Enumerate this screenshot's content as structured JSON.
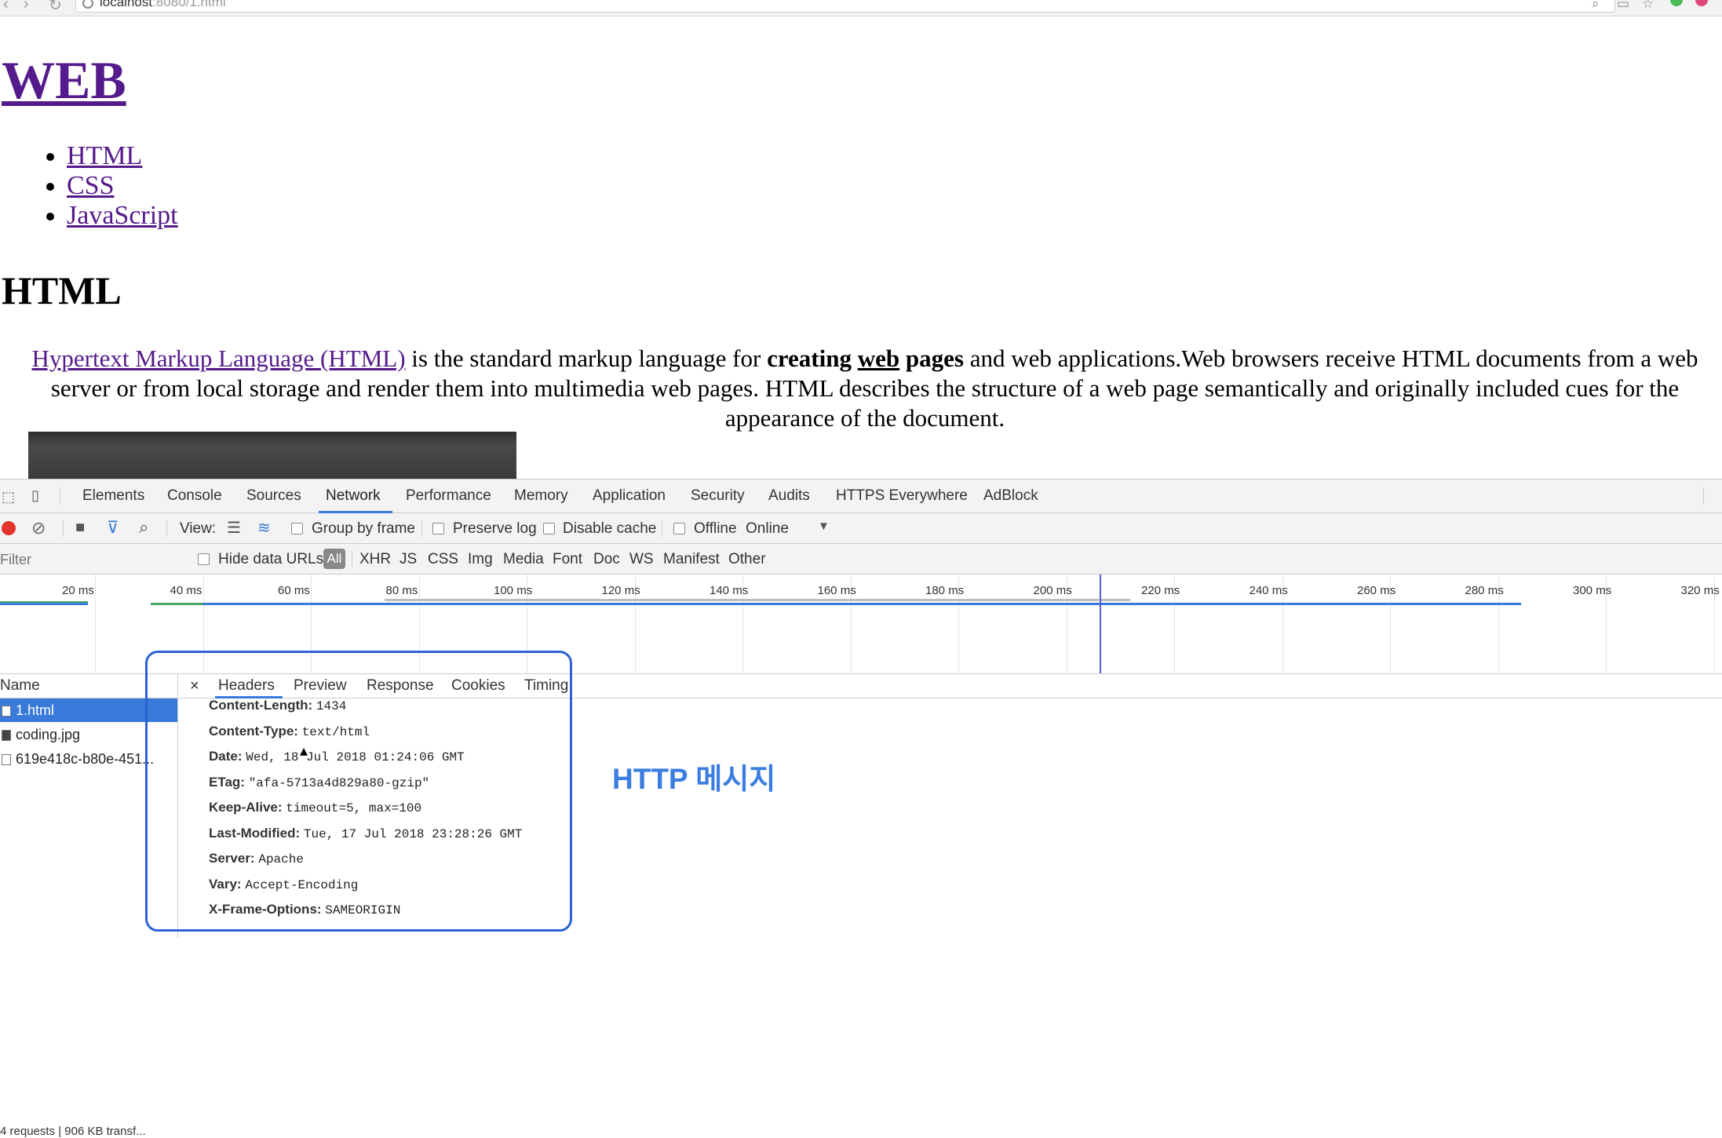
{
  "browser": {
    "url_host": "localhost",
    "url_rest": ":8080/1.html"
  },
  "page": {
    "title": "WEB",
    "nav": [
      "HTML",
      "CSS",
      "JavaScript"
    ],
    "section_title": "HTML",
    "para_link": "Hypertext Markup Language (HTML)",
    "para_text1": " is the standard markup language for ",
    "para_bold1": "creating ",
    "para_bold_under": "web",
    "para_bold2": " pages",
    "para_text2": " and web applications.Web browsers receive HTML documents from a web server or from local storage and render them into multimedia web pages. HTML describes the structure of a web page semantically and originally included cues for the appearance of the document."
  },
  "devtools": {
    "tabs": [
      "Elements",
      "Console",
      "Sources",
      "Network",
      "Performance",
      "Memory",
      "Application",
      "Security",
      "Audits",
      "HTTPS Everywhere",
      "AdBlock"
    ],
    "toolbar": {
      "view_label": "View:",
      "group_by_frame": "Group by frame",
      "preserve_log": "Preserve log",
      "disable_cache": "Disable cache",
      "offline": "Offline",
      "throttle": "Online"
    },
    "filter": {
      "placeholder": "Filter",
      "hide_data_urls": "Hide data URLs",
      "types": [
        "All",
        "XHR",
        "JS",
        "CSS",
        "Img",
        "Media",
        "Font",
        "Doc",
        "WS",
        "Manifest",
        "Other"
      ]
    },
    "timeline_ticks": [
      "20 ms",
      "40 ms",
      "60 ms",
      "80 ms",
      "100 ms",
      "120 ms",
      "140 ms",
      "160 ms",
      "180 ms",
      "200 ms",
      "220 ms",
      "240 ms",
      "260 ms",
      "280 ms",
      "300 ms",
      "320 ms"
    ],
    "name_header": "Name",
    "requests": [
      "1.html",
      "coding.jpg",
      "619e418c-b80e-451..."
    ],
    "status": "4 requests | 906 KB transf...",
    "detail_tabs": [
      "Headers",
      "Preview",
      "Response",
      "Cookies",
      "Timing"
    ],
    "close_symbol": "×",
    "headers": [
      {
        "key": "Content-Length:",
        "value": "1434"
      },
      {
        "key": "Content-Type:",
        "value": "text/html"
      },
      {
        "key": "Date:",
        "value": "Wed, 18 Jul 2018 01:24:06 GMT"
      },
      {
        "key": "ETag:",
        "value": "\"afa-5713a4d829a80-gzip\""
      },
      {
        "key": "Keep-Alive:",
        "value": "timeout=5, max=100"
      },
      {
        "key": "Last-Modified:",
        "value": "Tue, 17 Jul 2018 23:28:26 GMT"
      },
      {
        "key": "Server:",
        "value": "Apache"
      },
      {
        "key": "Vary:",
        "value": "Accept-Encoding"
      },
      {
        "key": "X-Frame-Options:",
        "value": "SAMEORIGIN"
      }
    ]
  },
  "annotation": "HTTP 메시지",
  "colors": {
    "link_visited": "#551a8b",
    "accent_blue": "#3879d9",
    "annotation_blue": "#3b7de0",
    "highlight_border": "#2b62d4"
  }
}
